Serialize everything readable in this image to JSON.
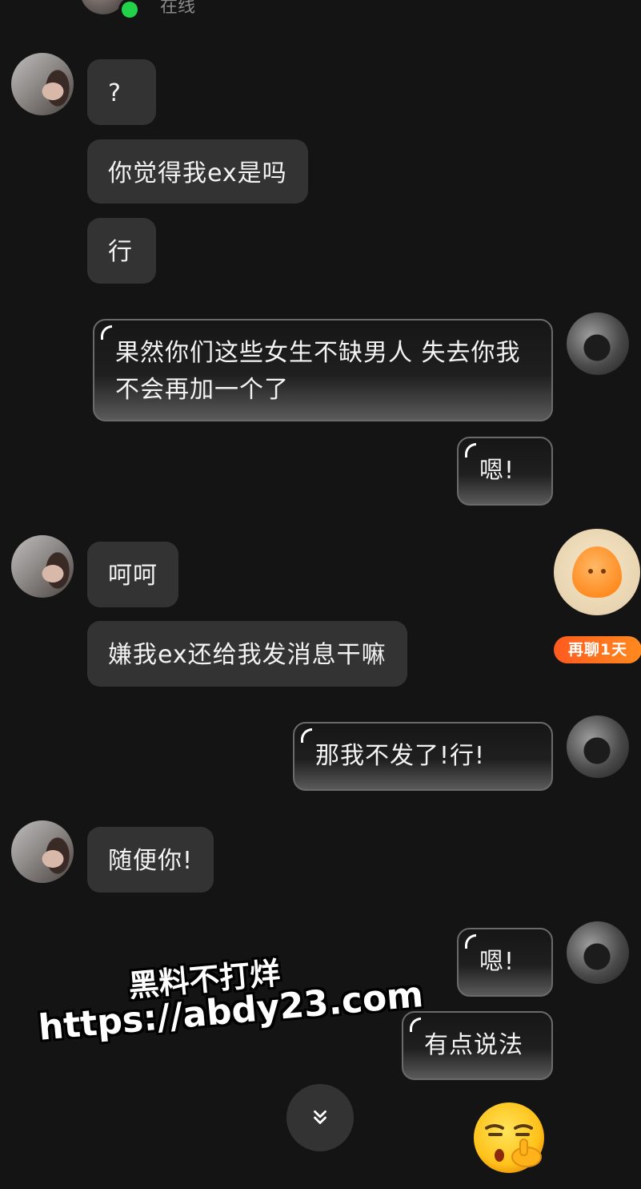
{
  "header": {
    "online_status": "在线"
  },
  "messages": [
    {
      "side": "in",
      "text": "?"
    },
    {
      "side": "in",
      "text": "你觉得我ex是吗"
    },
    {
      "side": "in",
      "text": "行"
    },
    {
      "side": "out",
      "text": "果然你们这些女生不缺男人 失去你我不会再加一个了"
    },
    {
      "side": "out",
      "text": "嗯!"
    },
    {
      "side": "in",
      "text": "呵呵"
    },
    {
      "side": "in",
      "text": "嫌我ex还给我发消息干嘛"
    },
    {
      "side": "out",
      "text": "那我不发了!行!"
    },
    {
      "side": "in",
      "text": "随便你!"
    },
    {
      "side": "out",
      "text": "嗯!"
    },
    {
      "side": "out",
      "text": "有点说法"
    }
  ],
  "floating": {
    "mascot_badge": "再聊1天",
    "scroll_icon": "chevrons-down-icon",
    "sticker": "shushing-face-emoji"
  },
  "watermark": {
    "line1": "黑料不打烊",
    "line2": "https://abdy23.com"
  },
  "colors": {
    "background": "#141414",
    "incoming_bubble": "#333333",
    "online_dot": "#22d34a",
    "badge": "#ff6a1f"
  }
}
